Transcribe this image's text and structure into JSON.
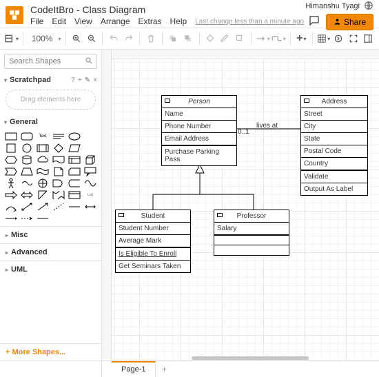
{
  "header": {
    "title": "CodeItBro - Class Diagram",
    "user": "Himanshu Tyagi",
    "share": "Share",
    "menu": [
      "File",
      "Edit",
      "View",
      "Arrange",
      "Extras",
      "Help"
    ],
    "lastchange": "Last change less than a minute ago"
  },
  "toolbar": {
    "zoom": "100%"
  },
  "sidebar": {
    "search_ph": "Search Shapes",
    "scratchpad": "Scratchpad",
    "drop": "Drag elements here",
    "general": "General",
    "misc": "Misc",
    "advanced": "Advanced",
    "uml": "UML",
    "more": "+ More Shapes..."
  },
  "uml": {
    "person": {
      "title": "Person",
      "attrs": [
        "Name",
        "Phone Number",
        "Email Address"
      ],
      "ops": [
        "Purchase Parking Pass"
      ]
    },
    "address": {
      "title": "Address",
      "attrs": [
        "Street",
        "City",
        "State",
        "Postal Code",
        "Country"
      ],
      "ops": [
        "Validate",
        "Output As Label"
      ]
    },
    "student": {
      "title": "Student",
      "attrs": [
        "Student Number",
        "Average Mark"
      ],
      "ops": [
        "Is Eligible To Enroll",
        "Get Seminars Taken"
      ]
    },
    "professor": {
      "title": "Professor",
      "attrs": [
        "Salary"
      ]
    }
  },
  "rel": {
    "lives": "lives at",
    "mult": "0..1"
  },
  "footer": {
    "page": "Page-1"
  },
  "chart_data": {
    "type": "uml-class-diagram",
    "classes": [
      {
        "name": "Person",
        "stereotype": "abstract",
        "attributes": [
          "Name",
          "Phone Number",
          "Email Address"
        ],
        "operations": [
          "Purchase Parking Pass"
        ]
      },
      {
        "name": "Address",
        "attributes": [
          "Street",
          "City",
          "State",
          "Postal Code",
          "Country"
        ],
        "operations": [
          "Validate",
          "Output As Label"
        ]
      },
      {
        "name": "Student",
        "attributes": [
          "Student Number",
          "Average Mark"
        ],
        "operations": [
          "Is Eligible To Enroll",
          "Get Seminars Taken"
        ]
      },
      {
        "name": "Professor",
        "attributes": [
          "Salary"
        ],
        "operations": []
      }
    ],
    "relationships": [
      {
        "from": "Person",
        "to": "Address",
        "type": "association",
        "label": "lives at",
        "multiplicity_from": "0..1"
      },
      {
        "from": "Student",
        "to": "Person",
        "type": "generalization"
      },
      {
        "from": "Professor",
        "to": "Person",
        "type": "generalization"
      }
    ]
  }
}
